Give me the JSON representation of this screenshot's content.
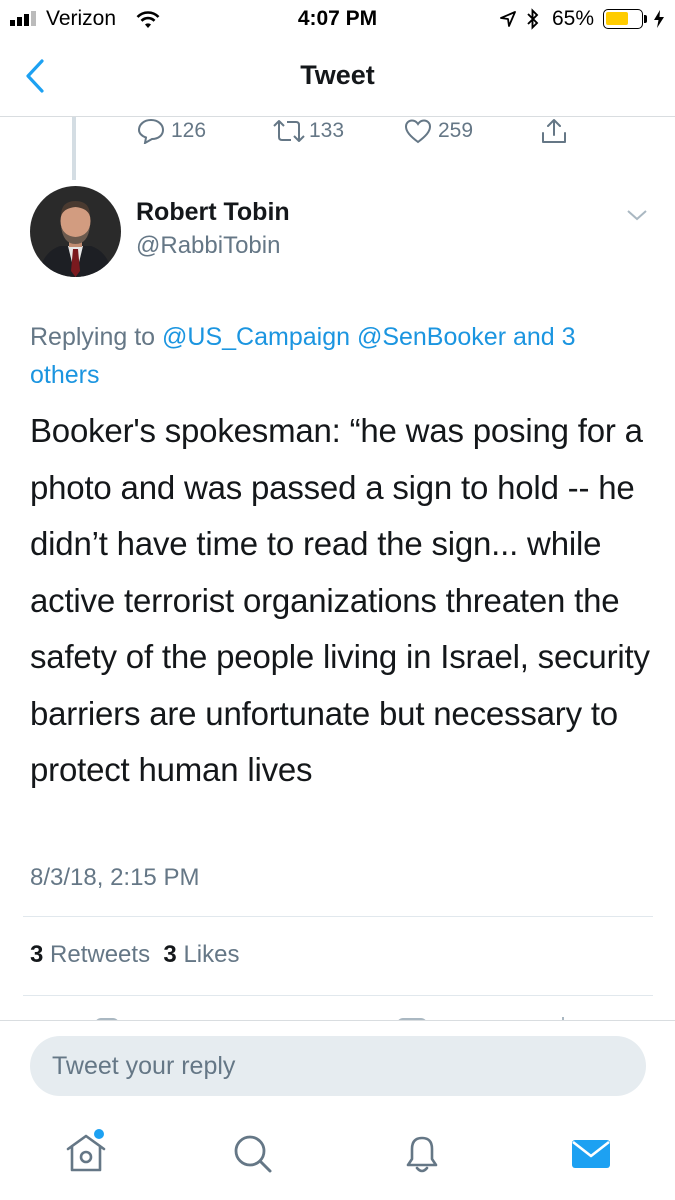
{
  "status_bar": {
    "carrier": "Verizon",
    "time": "4:07 PM",
    "battery": "65%",
    "battery_level": 0.65,
    "signal_icon": "signal-bars-icon",
    "wifi_icon": "wifi-icon",
    "location_icon": "location-arrow-icon",
    "bluetooth_icon": "bluetooth-icon"
  },
  "nav": {
    "title": "Tweet",
    "back_icon": "chevron-left-icon"
  },
  "previous_tweet_actions": {
    "reply_count": "126",
    "retweet_count": "133",
    "like_count": "259"
  },
  "tweet": {
    "author_name": "Robert Tobin",
    "author_handle": "@RabbiTobin",
    "reply_prefix": "Replying to",
    "reply_mentions": "@US_Campaign @SenBooker and 3 others",
    "text": "Booker's spokesman: “hе was posing for a photo and was passed a sign to hold -- he didn’t have time to read the sign... while active terrorist organizations threaten the safety of the people living in Israel, security barriers are unfortunate but necessary to protect human lives",
    "timestamp": "8/3/18, 2:15 PM",
    "retweets_count": "3",
    "retweets_label": "Retweets",
    "likes_count": "3",
    "likes_label": "Likes"
  },
  "composer": {
    "placeholder": "Tweet your reply"
  },
  "colors": {
    "accent": "#1da1f2",
    "link": "#1b95e0",
    "secondary_text": "#657786",
    "battery": "#ffcc00"
  }
}
